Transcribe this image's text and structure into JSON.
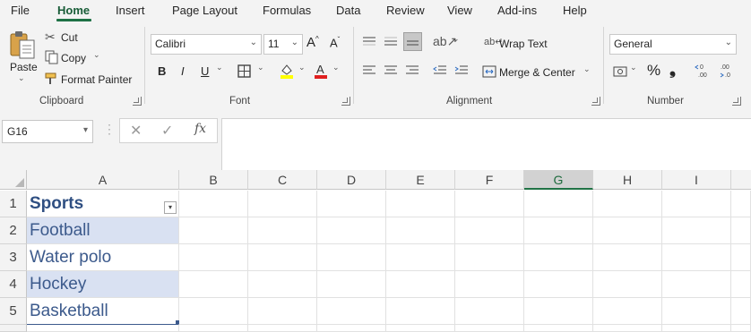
{
  "menu": {
    "tabs": [
      "File",
      "Home",
      "Insert",
      "Page Layout",
      "Formulas",
      "Data",
      "Review",
      "View",
      "Add-ins",
      "Help"
    ],
    "active": "Home"
  },
  "ribbon": {
    "clipboard": {
      "label": "Clipboard",
      "paste": "Paste",
      "cut": "Cut",
      "copy": "Copy",
      "format_painter": "Format Painter"
    },
    "font": {
      "label": "Font",
      "family": "Calibri",
      "size": "11",
      "bold": "B",
      "italic": "I",
      "underline": "U"
    },
    "alignment": {
      "label": "Alignment",
      "wrap_text": "Wrap Text",
      "merge_center": "Merge & Center"
    },
    "number": {
      "label": "Number",
      "format": "General",
      "percent": "%",
      "comma": "❟"
    }
  },
  "formula_bar": {
    "name_box": "G16",
    "fx": "fx",
    "value": ""
  },
  "sheet": {
    "columns": [
      "A",
      "B",
      "C",
      "D",
      "E",
      "F",
      "G",
      "H",
      "I"
    ],
    "selected_column": "G",
    "rows": [
      "1",
      "2",
      "3",
      "4",
      "5"
    ],
    "column_a": [
      "Sports",
      "Football",
      "Water polo",
      "Hockey",
      "Basketball"
    ]
  },
  "colors": {
    "accent": "#217346",
    "table_text": "#3c5a8c",
    "band": "#d9e1f2"
  }
}
